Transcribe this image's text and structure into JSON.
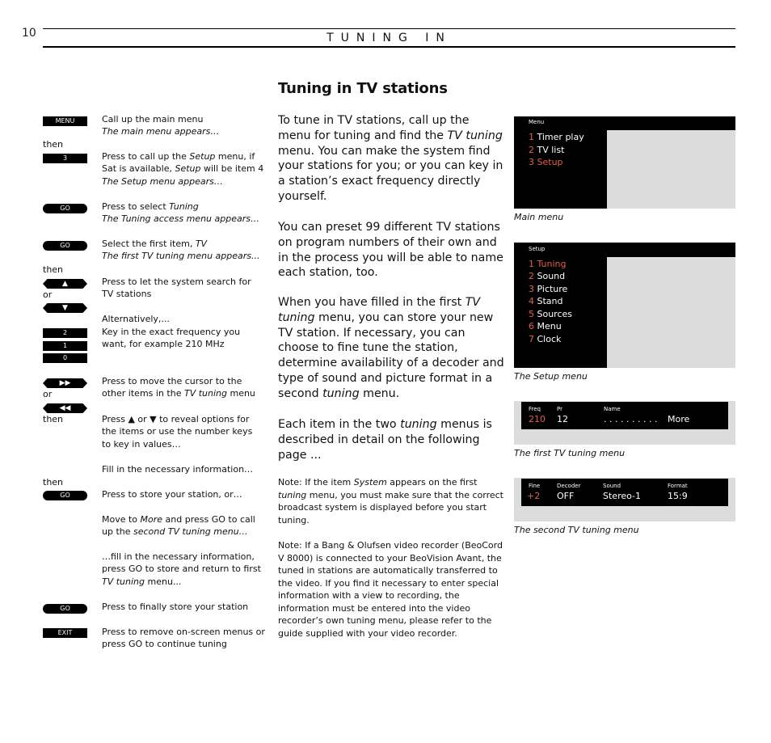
{
  "page": {
    "number": "10",
    "section": "TUNING IN",
    "title": "Tuning in TV stations"
  },
  "steps": [
    {
      "key": "MENU",
      "text": "Call up the main menu",
      "result": "The main menu appears…"
    },
    {
      "connector": "then"
    },
    {
      "key": "3",
      "text_pre": "Press to call up the ",
      "text_em": "Setup",
      "text_mid": " menu, if Sat is available, ",
      "text_em2": "Setup",
      "text_post": " will be item 4",
      "result": "The Setup menu appears…"
    },
    {
      "key": "GO",
      "text_pre": "Press to select ",
      "text_em": "Tuning",
      "result": "The Tuning access menu appears…"
    },
    {
      "key": "GO",
      "text_pre": "Select the first item, ",
      "text_em": "TV",
      "result": "The first TV tuning menu appears..."
    },
    {
      "connector": "then"
    },
    {
      "key": "▲",
      "text": "Press to let the system search for TV stations"
    },
    {
      "connector": "or"
    },
    {
      "key": "▼"
    },
    {
      "text": "Alternatively,..."
    },
    {
      "keys": [
        "2",
        "1",
        "0"
      ],
      "text": "Key in the exact frequency you want, for example 210 MHz"
    },
    {
      "key": "▶▶",
      "text_pre": "Press to move the cursor to the other items in the ",
      "text_em": "TV tuning",
      "text_post": " menu"
    },
    {
      "connector": "or"
    },
    {
      "key": "◀◀"
    },
    {
      "connector": "then",
      "text": "Press ▲ or ▼ to reveal options for the items or use the number keys to key in values…"
    },
    {
      "text": "Fill in the necessary information…"
    },
    {
      "connector": "then"
    },
    {
      "key": "GO",
      "text": "Press to store your station, or…"
    },
    {
      "text_pre": "Move to ",
      "text_em": "More",
      "text_mid": " and press GO to call up the ",
      "text_em2": "second TV tuning menu…"
    },
    {
      "text_pre": "…fill in the necessary information, press GO to store and return to first ",
      "text_em": "TV tuning",
      "text_post": " menu..."
    },
    {
      "key": "GO",
      "text": "Press to finally store your station"
    },
    {
      "key": "EXIT",
      "text": "Press to remove on-screen menus or press GO to continue tuning"
    }
  ],
  "body": {
    "p1_a": "To tune in TV stations, call up the menu for tuning and find the ",
    "p1_em": "TV tuning",
    "p1_b": " menu. You can make the system find your stations for you; or you can key in a station’s exact frequency directly yourself.",
    "p2": "You can preset 99 different TV stations on program numbers of their own and in the process you will be able to name each station, too.",
    "p3_a": "When you have filled in the first ",
    "p3_em": "TV tuning",
    "p3_b": " menu, you can store your new TV station. If necessary, you can choose to fine tune the station, determine availability of a decoder and type of sound and picture format in a second ",
    "p3_em2": "tuning",
    "p3_c": " menu.",
    "p4_a": "Each item in the two ",
    "p4_em": "tuning",
    "p4_b": " menus is described in detail on the following page ...",
    "note1_a": "Note: If the item ",
    "note1_em": "System",
    "note1_b": " appears on the first ",
    "note1_em2": "tuning",
    "note1_c": " menu, you must make sure that the correct broadcast system is displayed before you start tuning.",
    "note2": "Note: If a Bang & Olufsen video recorder (BeoCord V 8000) is connected to your BeoVision Avant, the tuned in stations are automatically transferred to the video. If you find it necessary to enter special information with a view to recording, the information must be entered into the video recorder’s own tuning menu, please refer to the guide supplied with your video recorder."
  },
  "screens": {
    "main_menu": {
      "header": "Menu",
      "items": [
        {
          "num": "1",
          "label": "Timer play",
          "selected": false
        },
        {
          "num": "2",
          "label": "TV list",
          "selected": false
        },
        {
          "num": "3",
          "label": "Setup",
          "selected": true
        }
      ],
      "caption": "Main menu"
    },
    "setup_menu": {
      "header": "Setup",
      "items": [
        {
          "num": "1",
          "label": "Tuning",
          "selected": true
        },
        {
          "num": "2",
          "label": "Sound",
          "selected": false
        },
        {
          "num": "3",
          "label": "Picture",
          "selected": false
        },
        {
          "num": "4",
          "label": "Stand",
          "selected": false
        },
        {
          "num": "5",
          "label": "Sources",
          "selected": false
        },
        {
          "num": "6",
          "label": "Menu",
          "selected": false
        },
        {
          "num": "7",
          "label": "Clock",
          "selected": false
        }
      ],
      "caption": "The Setup menu"
    },
    "first_tuning": {
      "fields": [
        {
          "label": "Freq",
          "value": "210"
        },
        {
          "label": "Pr",
          "value": "12"
        },
        {
          "label": "Name",
          "value": ". . . . . . . . . ."
        }
      ],
      "more": "More",
      "caption": "The first TV tuning menu"
    },
    "second_tuning": {
      "fields": [
        {
          "label": "Fine",
          "value": "+2"
        },
        {
          "label": "Decoder",
          "value": "OFF"
        },
        {
          "label": "Sound",
          "value": "Stereo-1"
        },
        {
          "label": "Format",
          "value": "15:9"
        }
      ],
      "caption": "The second TV tuning menu"
    }
  },
  "colors": {
    "highlight": "#e0604a",
    "screen_bg": "#000000",
    "screen_panel": "#dcdcdc"
  }
}
